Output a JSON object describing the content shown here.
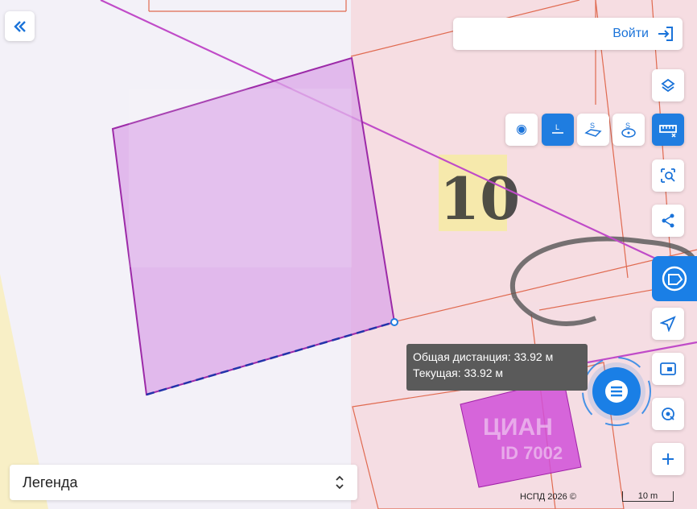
{
  "header": {
    "login_label": "Войти"
  },
  "tooltip": {
    "total_distance": "Общая дистанция: 33.92 м",
    "current_distance": "Текущая: 33.92 м"
  },
  "map": {
    "parcel_label": "10",
    "watermark_text": "ЦИАН",
    "watermark_id": "ID 7002",
    "attribution": "НСПД 2026 ©",
    "scale_label": "10 m"
  },
  "legend": {
    "label": "Легенда"
  },
  "toolbar": {
    "collapse_icon": "double-chevron-left-icon",
    "login_icon": "sign-in-icon",
    "buttons": [
      "layers-icon",
      "ruler-icon",
      "area-search-icon",
      "share-icon",
      "locate-icon",
      "rectangle-select-icon",
      "search-location-icon",
      "zoom-in-icon"
    ],
    "measure_tools": [
      "point-icon",
      "line-icon",
      "area-polygon-icon",
      "area-circle-icon"
    ]
  },
  "colors": {
    "accent": "#1f7de0",
    "parcel_fill": "#d9a3e6",
    "boundary_red": "#d9553a",
    "measure_line": "#c04bc8"
  }
}
